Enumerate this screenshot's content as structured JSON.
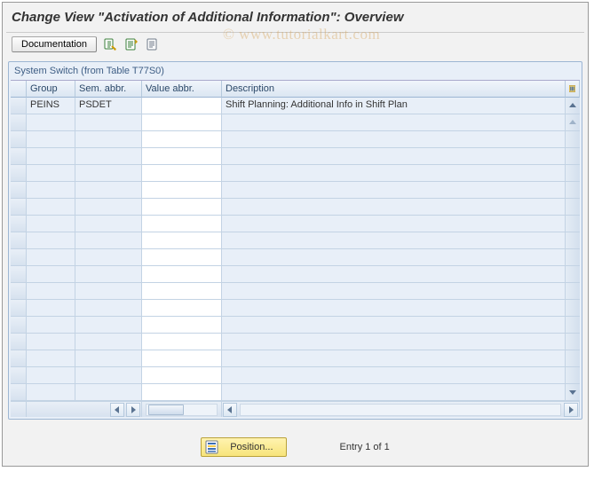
{
  "title": "Change View \"Activation of Additional Information\": Overview",
  "toolbar": {
    "documentation": "Documentation"
  },
  "panel": {
    "title": "System Switch (from Table T77S0)",
    "columns": {
      "group": "Group",
      "sem_abbr": "Sem. abbr.",
      "value_abbr": "Value abbr.",
      "description": "Description"
    },
    "rows": [
      {
        "group": "PEINS",
        "sem_abbr": "PSDET",
        "value_abbr": "",
        "description": "Shift Planning: Additional Info in Shift Plan"
      }
    ],
    "blank_rows": 17
  },
  "footer": {
    "position_label": "Position...",
    "entry_text": "Entry 1 of 1"
  },
  "watermark": "© www.tutorialkart.com"
}
